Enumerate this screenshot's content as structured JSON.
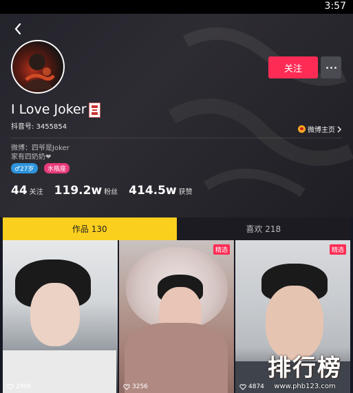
{
  "status_bar": {
    "time": "3:57"
  },
  "profile": {
    "follow_label": "关注",
    "nickname": "I Love Joker",
    "douyin_id": "抖音号: 3455854",
    "weibo_link": "微博主页",
    "bio_lines": [
      "微博：四爷是Joker",
      "家有四奶奶❤"
    ],
    "tags": {
      "age": "♂27岁",
      "zodiac": "水瓶座"
    },
    "stats": [
      {
        "value": "44",
        "label": "关注"
      },
      {
        "value": "119.2w",
        "label": "粉丝"
      },
      {
        "value": "414.5w",
        "label": "获赞"
      }
    ]
  },
  "tabs": [
    {
      "label": "作品 130",
      "active": true
    },
    {
      "label": "喜欢 218",
      "active": false
    }
  ],
  "videos": [
    {
      "likes": "2906",
      "featured": false
    },
    {
      "likes": "3256",
      "featured": true,
      "badge": "精选"
    },
    {
      "likes": "4874",
      "featured": true,
      "badge": "精选"
    }
  ],
  "watermark": {
    "title": "排行榜",
    "url": "www.phb123.com"
  },
  "colors": {
    "accent": "#fe2c55",
    "tab_active": "#facf1e",
    "background": "#161823"
  },
  "icons": [
    "back-arrow-icon",
    "more-dots-icon",
    "weibo-icon",
    "heart-icon"
  ]
}
